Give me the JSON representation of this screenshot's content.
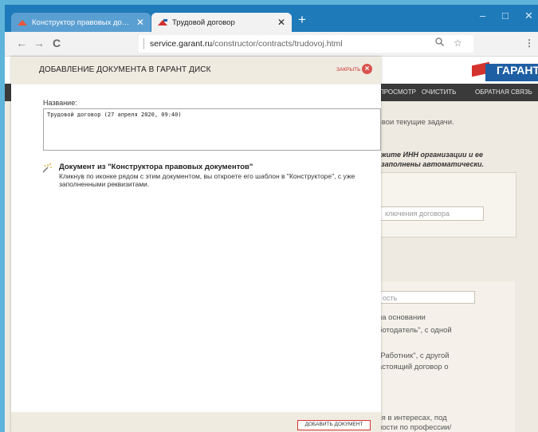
{
  "browser": {
    "tabs": [
      {
        "title": "Конструктор правовых докуме",
        "active": false
      },
      {
        "title": "Трудовой договор",
        "active": true
      }
    ],
    "new_tab_symbol": "+",
    "url_domain": "service.garant.ru",
    "url_path": "/constructor/contracts/trudovoj.html",
    "icons": {
      "back": "←",
      "forward": "→",
      "reload": "C",
      "zoom": "🔍",
      "star": "☆",
      "menu": "⋮",
      "minimize": "–",
      "maximize": "□",
      "close": "✕"
    }
  },
  "site": {
    "logo": "ГАРАНТ",
    "nav": [
      "ПРОСМОТР",
      "ОЧИСТИТЬ",
      "ОБРАТНАЯ СВЯЗЬ"
    ],
    "tasks_text": "свои текущие задачи.",
    "hint_line1": "жите ИНН организации и ее",
    "hint_line2": "заполнены автоматически.",
    "contract_input_placeholder": "ключения договора",
    "city_field": "ость",
    "body_lines": [
      "на основании",
      "ботодатель\", с одной",
      "\"Работник\", с другой",
      "астоящий договор о",
      "ся в интересах, под",
      "ности по профессии/"
    ]
  },
  "modal": {
    "title": "ДОБАВЛЕНИЕ ДОКУМЕНТА В ГАРАНТ ДИСК",
    "close_label": "ЗАКРЫТЬ",
    "name_label": "Название:",
    "name_value": "Трудовой договор (27 апреля 2020, 09:40)",
    "doc_heading": "Документ из \"Конструктора правовых документов\"",
    "doc_description": "Кликнув по иконке рядом с этим документом, вы откроете его шаблон в \"Конструкторе\", с уже заполненными реквизитами.",
    "add_button_label": "ДОБАВИТЬ ДОКУМЕНТ"
  },
  "colors": {
    "titlebar": "#1f7ab9",
    "accent_red": "#d4322c",
    "modal_band": "#f0ebe1"
  }
}
